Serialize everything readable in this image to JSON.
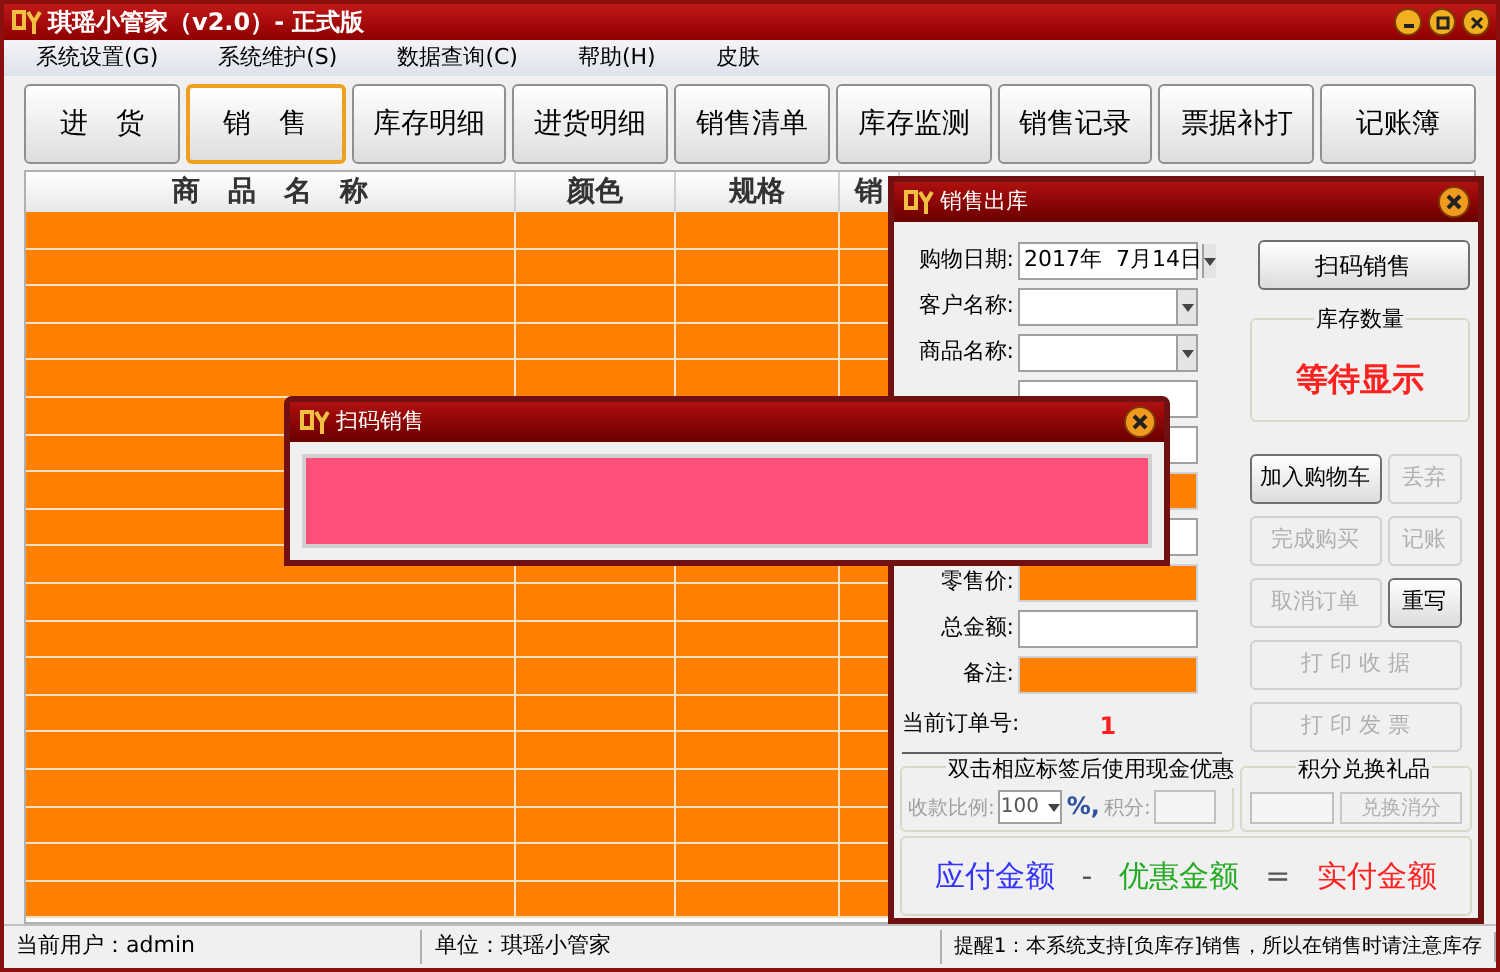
{
  "window": {
    "title": "琪瑶小管家（v2.0）- 正式版"
  },
  "menu": [
    {
      "label": "系统设置(G)"
    },
    {
      "label": "系统维护(S)"
    },
    {
      "label": "数据查询(C)"
    },
    {
      "label": "帮助(H)"
    },
    {
      "label": "皮肤"
    }
  ],
  "toolbar": [
    {
      "label": "进　货",
      "selected": false
    },
    {
      "label": "销　售",
      "selected": true
    },
    {
      "label": "库存明细",
      "selected": false
    },
    {
      "label": "进货明细",
      "selected": false
    },
    {
      "label": "销售清单",
      "selected": false
    },
    {
      "label": "库存监测",
      "selected": false
    },
    {
      "label": "销售记录",
      "selected": false
    },
    {
      "label": "票据补打",
      "selected": false
    },
    {
      "label": "记账簿",
      "selected": false
    }
  ],
  "table": {
    "columns": [
      "商　品　名　称",
      "颜色",
      "规格",
      "销"
    ]
  },
  "status_bar": [
    "当前用户：admin",
    "单位：琪瑶小管家",
    "提醒1：本系统支持[负库存]销售，所以在销售时请注意库存"
  ],
  "sales_dialog": {
    "title": "销售出库",
    "fields": [
      {
        "label": "购物日期:",
        "kind": "date",
        "value": "2017年  7月14日",
        "highlighted": false
      },
      {
        "label": "客户名称:",
        "kind": "dropdown",
        "highlighted": false
      },
      {
        "label": "商品名称:",
        "kind": "dropdown",
        "highlighted": false
      },
      {
        "kind": "input",
        "highlighted": false
      },
      {
        "kind": "input",
        "highlighted": false
      },
      {
        "kind": "input",
        "highlighted": true
      },
      {
        "kind": "input",
        "highlighted": false
      },
      {
        "label": "零售价:",
        "kind": "input",
        "highlighted": true
      },
      {
        "label": "总金额:",
        "kind": "input",
        "highlighted": false
      },
      {
        "label": "备注:",
        "kind": "input",
        "highlighted": true
      }
    ],
    "order_label": "当前订单号:",
    "order_number": "1",
    "scan_button": "扫码销售",
    "stock": {
      "title": "库存数量",
      "value": "等待显示"
    },
    "button_rows": [
      [
        {
          "label": "加入购物车",
          "disabled": false
        },
        {
          "label": "丢弃",
          "disabled": true
        }
      ],
      [
        {
          "label": "完成购买",
          "disabled": true
        },
        {
          "label": "记账",
          "disabled": true
        }
      ],
      [
        {
          "label": "取消订单",
          "disabled": true
        },
        {
          "label": "重写",
          "disabled": false
        }
      ],
      [
        {
          "label": "打 印 收 据",
          "disabled": true
        }
      ],
      [
        {
          "label": "打 印 发 票",
          "disabled": true
        }
      ]
    ],
    "discount": {
      "title": "双击相应标签后使用现金优惠",
      "ratio_label": "收款比例:",
      "ratio_value": "100",
      "percent": "%,",
      "points_label": "积分:"
    },
    "points": {
      "title": "积分兑换礼品",
      "button": "兑换消分"
    },
    "summary": [
      {
        "text": "应付金额",
        "color": "#3333ff"
      },
      {
        "text": "-",
        "color": "#555555"
      },
      {
        "text": "优惠金额",
        "color": "#22aa22"
      },
      {
        "text": "=",
        "color": "#555555"
      },
      {
        "text": "实付金额",
        "color": "#ff2222"
      }
    ]
  },
  "scan_dialog": {
    "title": "扫码销售",
    "input_highlighted": true
  }
}
